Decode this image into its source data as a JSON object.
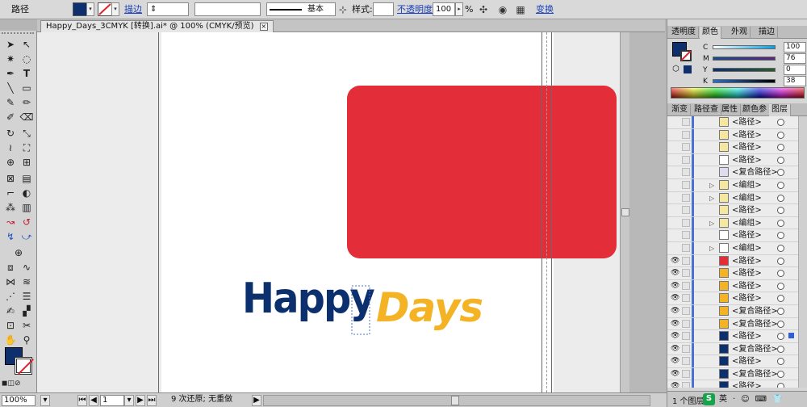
{
  "control_bar": {
    "object_label": "路径",
    "stroke_link": "描边",
    "stroke_profile": "基本",
    "style_label": "样式:",
    "opacity_link": "不透明度",
    "opacity_value": "100",
    "opacity_unit": "%",
    "transform_link": "变换",
    "fill_color": "#0e2f6e"
  },
  "document": {
    "tab_title": "Happy_Days_3CMYK [转换].ai* @ 100% (CMYK/预览)",
    "logo_word1": "Happy",
    "logo_word2": "Days",
    "card_color": "#e32d38",
    "navy": "#0c2f6e",
    "gold": "#f3b324"
  },
  "status_bar": {
    "zoom": "100%",
    "artboard_number": "1",
    "undo_status": "9 次还原; 无重做"
  },
  "tools": [
    "selection-tool",
    "direct-selection-tool",
    "magic-wand-tool",
    "lasso-tool",
    "pen-tool",
    "type-tool",
    "line-segment-tool",
    "rectangle-tool",
    "paintbrush-tool",
    "pencil-tool",
    "blob-brush-tool",
    "eraser-tool",
    "rotate-tool",
    "scale-tool",
    "warp-tool",
    "free-transform-tool",
    "shape-builder-tool",
    "perspective-grid-tool",
    "mesh-tool",
    "gradient-tool",
    "eyedropper-tool",
    "blend-tool",
    "symbol-sprayer-tool",
    "column-graph-tool",
    "artboard-tool",
    "slice-tool",
    "hand-tool",
    "zoom-tool"
  ],
  "color_panel": {
    "tabs": [
      "透明度",
      "颜色",
      "外观",
      "描边"
    ],
    "active_tab": "颜色",
    "channels": [
      {
        "label": "C",
        "value": "100"
      },
      {
        "label": "M",
        "value": "76"
      },
      {
        "label": "Y",
        "value": "0"
      },
      {
        "label": "K",
        "value": "38"
      }
    ]
  },
  "layers_panel": {
    "tabs": [
      "渐变",
      "路径查",
      "属性",
      "颜色参",
      "图层"
    ],
    "active_tab": "图层",
    "rows": [
      {
        "name": "<路径>"
      },
      {
        "name": "<路径>"
      },
      {
        "name": "<路径>"
      },
      {
        "name": "<路径>"
      },
      {
        "name": "<复合路径>"
      },
      {
        "name": "<编组>"
      },
      {
        "name": "<编组>"
      },
      {
        "name": "<路径>"
      },
      {
        "name": "<编组>"
      },
      {
        "name": "<路径>"
      },
      {
        "name": "<编组>"
      },
      {
        "name": "<路径>"
      },
      {
        "name": "<路径>"
      },
      {
        "name": "<路径>"
      },
      {
        "name": "<路径>"
      },
      {
        "name": "<复合路径>"
      },
      {
        "name": "<复合路径>"
      },
      {
        "name": "<路径>"
      },
      {
        "name": "<复合路径>"
      },
      {
        "name": "<路径>"
      },
      {
        "name": "<复合路径>"
      },
      {
        "name": "<路径>"
      }
    ],
    "layer_count": "1 个图层",
    "ime": [
      "英",
      "·",
      "☺",
      "⌨",
      "👕"
    ]
  }
}
